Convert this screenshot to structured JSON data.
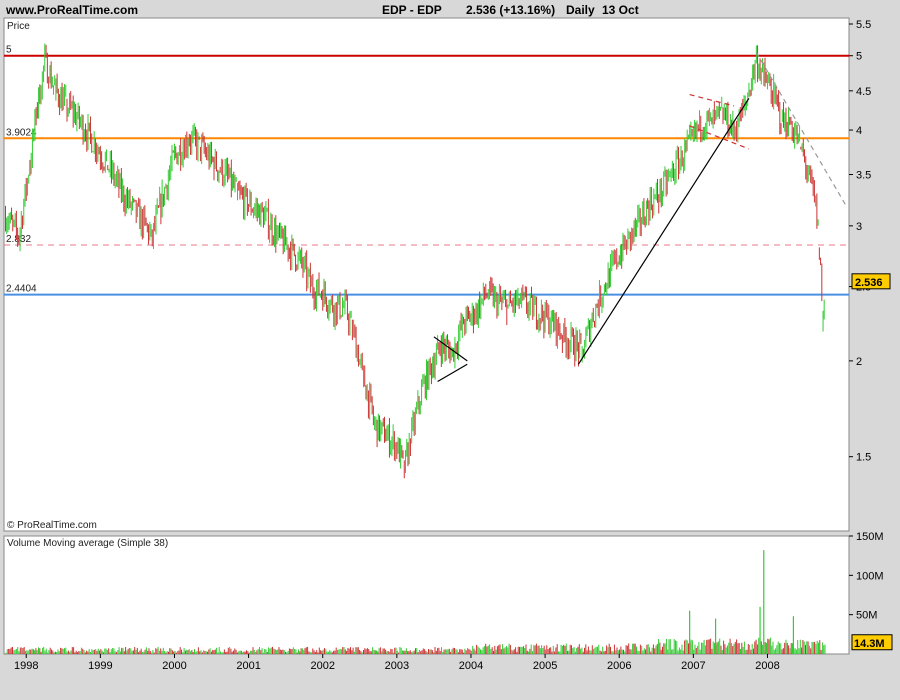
{
  "header": {
    "site": "www.ProRealTime.com",
    "title": "EDP - EDP",
    "last_value": "2.536 (+13.16%)",
    "period": "Daily",
    "date": "13 Oct"
  },
  "panels": {
    "price_label": "Price",
    "copyright": "© ProRealTime.com",
    "volume_label": "Volume Moving average (Simple 38)"
  },
  "colors": {
    "background": "#d8d8d8",
    "plot_bg": "#ffffff",
    "up": "#33cc33",
    "down": "#cc3333",
    "level_5": "#cc0000",
    "level_3_9024": "#ff8800",
    "level_2_832": "#e87a8a",
    "level_2_4404": "#4a90e2",
    "last_badge": "#ffcc00"
  },
  "chart_data": [
    {
      "type": "line",
      "series_name": "EDP - EDP",
      "y_scale": "log",
      "ylim": [
        1.2,
        5.6
      ],
      "yticks": [
        "5.5",
        "5",
        "4.5",
        "4",
        "3.5",
        "3",
        "2.5",
        "2",
        "1.5"
      ],
      "ytick_values": [
        5.5,
        5,
        4.5,
        4,
        3.5,
        3,
        2.5,
        2,
        1.5
      ],
      "x_labels": [
        "1998",
        "1999",
        "2000",
        "2001",
        "2002",
        "2003",
        "2004",
        "2005",
        "2006",
        "2007",
        "2008"
      ],
      "xlim": [
        1997.7,
        2009.1
      ],
      "x": [
        1997.72,
        1997.9,
        1998.05,
        1998.15,
        1998.25,
        1998.32,
        1998.4,
        1998.55,
        1998.65,
        1998.8,
        1998.95,
        1999.1,
        1999.3,
        1999.5,
        1999.7,
        1999.85,
        2000.0,
        2000.2,
        2000.35,
        2000.55,
        2000.7,
        2000.85,
        2001.0,
        2001.2,
        2001.4,
        2001.55,
        2001.7,
        2001.85,
        2002.0,
        2002.15,
        2002.3,
        2002.4,
        2002.55,
        2002.7,
        2002.85,
        2003.0,
        2003.1,
        2003.2,
        2003.35,
        2003.5,
        2003.6,
        2003.75,
        2003.9,
        2004.05,
        2004.2,
        2004.35,
        2004.5,
        2004.65,
        2004.8,
        2004.95,
        2005.1,
        2005.25,
        2005.4,
        2005.5,
        2005.65,
        2005.8,
        2005.95,
        2006.1,
        2006.25,
        2006.4,
        2006.55,
        2006.7,
        2006.85,
        2007.0,
        2007.1,
        2007.25,
        2007.4,
        2007.55,
        2007.7,
        2007.85,
        2007.95,
        2008.1,
        2008.2,
        2008.3,
        2008.45,
        2008.55,
        2008.65,
        2008.7,
        2008.75,
        2008.78
      ],
      "values": [
        3.1,
        2.9,
        3.6,
        4.3,
        4.9,
        4.7,
        4.5,
        4.3,
        4.2,
        4.0,
        3.8,
        3.6,
        3.3,
        3.1,
        2.9,
        3.3,
        3.7,
        3.9,
        3.8,
        3.6,
        3.5,
        3.3,
        3.2,
        3.1,
        2.9,
        2.8,
        2.7,
        2.5,
        2.45,
        2.35,
        2.35,
        2.2,
        1.9,
        1.65,
        1.6,
        1.55,
        1.45,
        1.6,
        1.85,
        2.0,
        2.1,
        2.05,
        2.25,
        2.3,
        2.45,
        2.4,
        2.35,
        2.4,
        2.35,
        2.3,
        2.25,
        2.15,
        2.1,
        2.05,
        2.3,
        2.5,
        2.7,
        2.85,
        3.0,
        3.2,
        3.3,
        3.5,
        3.7,
        3.9,
        4.1,
        4.1,
        4.2,
        4.0,
        4.3,
        4.95,
        4.7,
        4.4,
        4.1,
        4.1,
        3.8,
        3.5,
        3.2,
        2.8,
        2.25,
        2.536
      ],
      "last_label": "2.536",
      "horizontal_levels": [
        {
          "label": "5",
          "value": 5.0,
          "color": "#cc0000",
          "style": "solid"
        },
        {
          "label": "3.9024",
          "value": 3.9024,
          "color": "#ff8800",
          "style": "solid"
        },
        {
          "label": "2.832",
          "value": 2.832,
          "color": "#e87a8a",
          "style": "dashed"
        },
        {
          "label": "2.4404",
          "value": 2.4404,
          "color": "#4a90e2",
          "style": "solid"
        }
      ],
      "trendlines": [
        {
          "from": [
            2003.5,
            2.15
          ],
          "to": [
            2003.95,
            2.0
          ],
          "color": "#000000"
        },
        {
          "from": [
            2003.55,
            1.88
          ],
          "to": [
            2003.95,
            1.98
          ],
          "color": "#000000"
        },
        {
          "from": [
            2005.45,
            1.98
          ],
          "to": [
            2007.75,
            4.4
          ],
          "color": "#000000"
        },
        {
          "from": [
            2006.95,
            4.45
          ],
          "to": [
            2007.55,
            4.3
          ],
          "color": "#cc3333",
          "style": "dashed"
        },
        {
          "from": [
            2006.95,
            4.05
          ],
          "to": [
            2007.75,
            3.78
          ],
          "color": "#cc3333",
          "style": "dashed"
        },
        {
          "from": [
            2007.85,
            5.05
          ],
          "to": [
            2009.05,
            3.2
          ],
          "color": "#999999",
          "style": "dashed"
        }
      ]
    },
    {
      "type": "bar",
      "series_name": "Volume",
      "ylim": [
        0,
        150
      ],
      "yticks": [
        "150M",
        "100M",
        "50M"
      ],
      "ytick_values": [
        150,
        100,
        50
      ],
      "unit": "M",
      "spikes": [
        {
          "x": 2007.95,
          "value": 132
        },
        {
          "x": 2007.9,
          "value": 60
        },
        {
          "x": 2008.35,
          "value": 48
        },
        {
          "x": 2006.95,
          "value": 55
        },
        {
          "x": 2007.3,
          "value": 45
        }
      ],
      "last_label": "14.3M"
    }
  ]
}
